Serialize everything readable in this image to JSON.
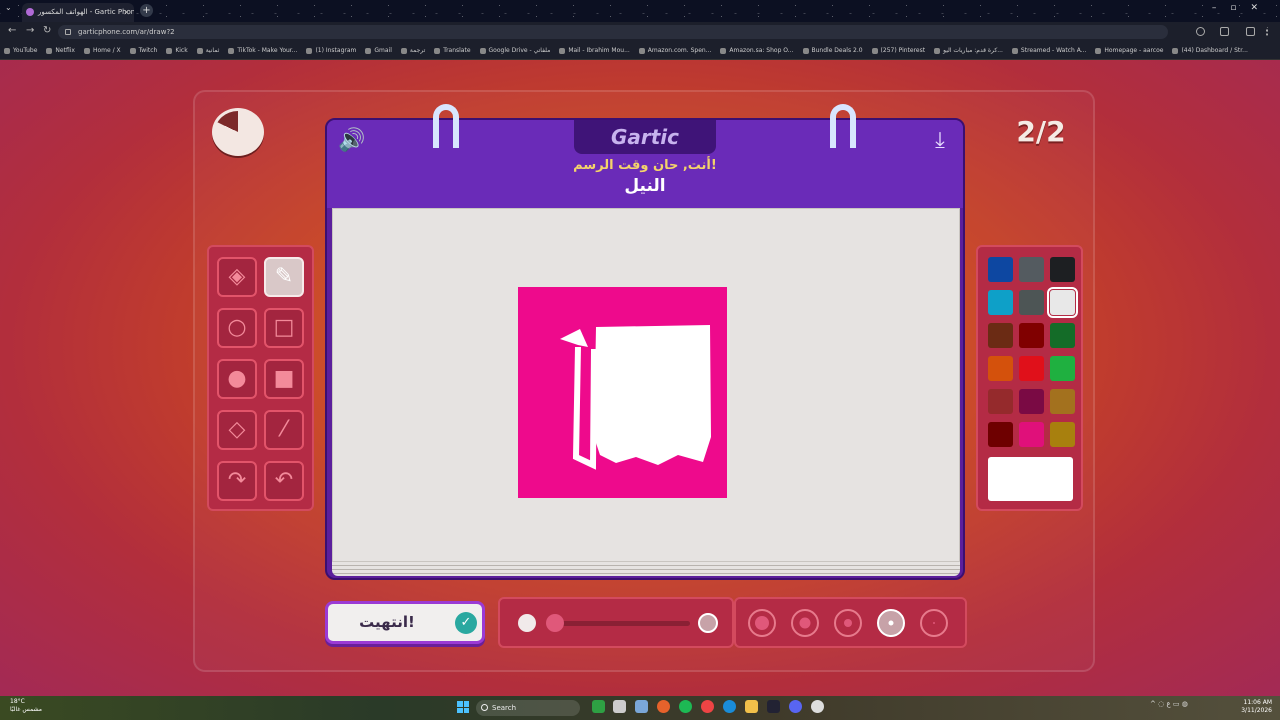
{
  "browser": {
    "tab_title": "الهواتف المكسور - Gartic Phone",
    "url": "garticphone.com/ar/draw?2",
    "bookmarks": [
      "YouTube",
      "Netflix",
      "Home / X",
      "Twitch",
      "Kick",
      "ثمانية",
      "TikTok - Make Your...",
      "(1) Instagram",
      "Gmail",
      "ترجمة",
      "Translate",
      "Google Drive - ملفاتي",
      "Mail - Ibrahim Mou...",
      "Amazon.com. Spen...",
      "Amazon.sa: Shop O...",
      "Bundle Deals 2.0",
      "(257) Pinterest",
      "كرة قدم: مباريات اليو...",
      "Streamed - Watch A...",
      "Homepage - aarcoe",
      "(44) Dashboard / Str..."
    ]
  },
  "game": {
    "logo": "Gartic",
    "prompt": "أنت, حان وقت الرسم!",
    "word": "النيل",
    "round": "2/2",
    "finish_label": "انتهيت!",
    "timer_remaining": 0.82
  },
  "tools": [
    "eraser",
    "pencil",
    "ellipse-outline",
    "rectangle-outline",
    "ellipse-filled",
    "rectangle-filled",
    "fill-bucket",
    "line",
    "undo",
    "redo"
  ],
  "selected_tool": "pencil",
  "palette": [
    "#0d47a1",
    "#545b60",
    "#1d1f22",
    "#0ea0c8",
    "#4d5555",
    "#e8e8e8",
    "#6b2b14",
    "#800000",
    "#146c28",
    "#d4510c",
    "#e0101a",
    "#1fb040",
    "#952a2c",
    "#7a0a44",
    "#a3711e",
    "#6e0000",
    "#e0107a",
    "#a8800e"
  ],
  "selected_color": "#e8e8e8",
  "current_color": "#ffffff",
  "canvas_fill": "#ee0a8c",
  "opacity_level": 1.0,
  "brush_sizes": 5,
  "selected_size_index": 3,
  "taskbar": {
    "weather_temp": "18°C",
    "weather_desc": "مشمس غالبًا",
    "search": "Search",
    "time": "11:06 AM",
    "date": "3/11/2026"
  }
}
